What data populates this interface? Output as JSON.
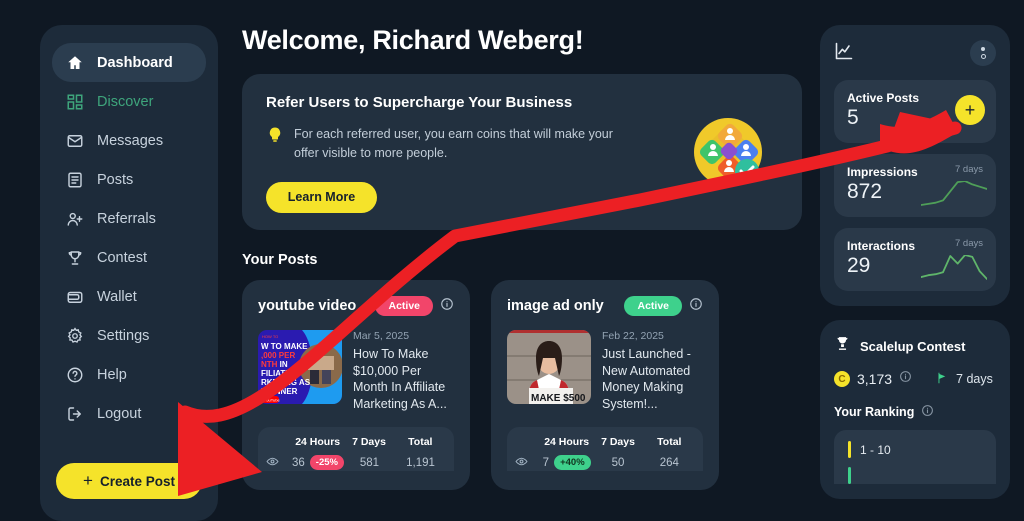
{
  "sidebar": {
    "items": [
      {
        "label": "Dashboard",
        "icon": "home-icon",
        "state": "active"
      },
      {
        "label": "Discover",
        "icon": "grid-icon",
        "state": "accent"
      },
      {
        "label": "Messages",
        "icon": "envelope-icon",
        "state": "normal"
      },
      {
        "label": "Posts",
        "icon": "document-icon",
        "state": "normal"
      },
      {
        "label": "Referrals",
        "icon": "user-plus-icon",
        "state": "normal"
      },
      {
        "label": "Contest",
        "icon": "trophy-icon",
        "state": "normal"
      },
      {
        "label": "Wallet",
        "icon": "wallet-icon",
        "state": "normal"
      },
      {
        "label": "Settings",
        "icon": "gear-icon",
        "state": "normal"
      },
      {
        "label": "Help",
        "icon": "question-circle-icon",
        "state": "normal"
      },
      {
        "label": "Logout",
        "icon": "logout-icon",
        "state": "normal"
      }
    ],
    "create_post_label": "Create Post",
    "create_post_plus": "+"
  },
  "header": {
    "welcome": "Welcome, Richard Weberg!"
  },
  "banner": {
    "title": "Refer Users to Supercharge Your Business",
    "body": "For each referred user, you earn coins that will make your offer visible to more people.",
    "cta_label": "Learn More",
    "bulb_icon": "lightbulb-icon",
    "art_icon": "referral-network-illustration"
  },
  "posts": {
    "section_title": "Your Posts",
    "stats_columns": [
      "24 Hours",
      "7 Days",
      "Total"
    ],
    "items": [
      {
        "name": "youtube video",
        "status": "Active",
        "status_color": "#f2456a",
        "date": "Mar 5, 2025",
        "description": "How To Make $10,000 Per Month In Affiliate Marketing As A...",
        "thumb": "youtube-thumbnail",
        "thumb_text": "W TO MAKE ,000 PER NTH IN FILIATE RKETING AS EGINNER",
        "stats": {
          "hours24": "36",
          "change": "-25%",
          "change_dir": "down",
          "days7": "581",
          "total": "1,191"
        }
      },
      {
        "name": "image ad only",
        "status": "Active",
        "status_color": "#3ed18c",
        "date": "Feb 22, 2025",
        "description": "Just Launched - New Automated Money Making System!...",
        "thumb": "woman-photo-thumbnail",
        "thumb_text": "MAKE $500",
        "stats": {
          "hours24": "7",
          "change": "+40%",
          "change_dir": "up",
          "days7": "50",
          "total": "264"
        }
      }
    ]
  },
  "right_panel": {
    "chart_icon": "line-chart-icon",
    "menu_icon": "filter-dots-icon",
    "add_icon": "plus-icon",
    "stats": [
      {
        "label": "Active Posts",
        "value": "5",
        "period": "",
        "has_add": true
      },
      {
        "label": "Impressions",
        "value": "872",
        "period": "7 days",
        "has_add": false
      },
      {
        "label": "Interactions",
        "value": "29",
        "period": "7 days",
        "has_add": false
      }
    ]
  },
  "contest": {
    "title": "Scalelup Contest",
    "trophy_icon": "trophy-icon",
    "coins": "3,173",
    "coin_symbol": "C",
    "days": "7 days",
    "flag_icon": "flag-icon",
    "ranking_label": "Your Ranking",
    "info_icon": "info-icon",
    "ranks": [
      {
        "label": "1 - 10",
        "color": "#f5e32a"
      },
      {
        "label": "",
        "color": "#3ed18c"
      }
    ]
  },
  "chart_data": {
    "type": "line",
    "title": "Impressions and Interactions sparklines",
    "series": [
      {
        "name": "Impressions",
        "values": [
          10,
          11,
          12,
          14,
          22,
          30,
          31,
          28,
          26,
          24
        ],
        "color": "#4f9f58"
      },
      {
        "name": "Interactions",
        "values": [
          8,
          10,
          11,
          13,
          30,
          22,
          31,
          29,
          14,
          6
        ],
        "color": "#5fb56a"
      }
    ],
    "xlabel": "",
    "ylabel": "",
    "grid": false,
    "legend": "none"
  },
  "annotation": {
    "type": "red-arrow",
    "color": "#ec2024",
    "description": "Red hand-drawn arrows pointing to Create Post button and Active Posts add button"
  }
}
